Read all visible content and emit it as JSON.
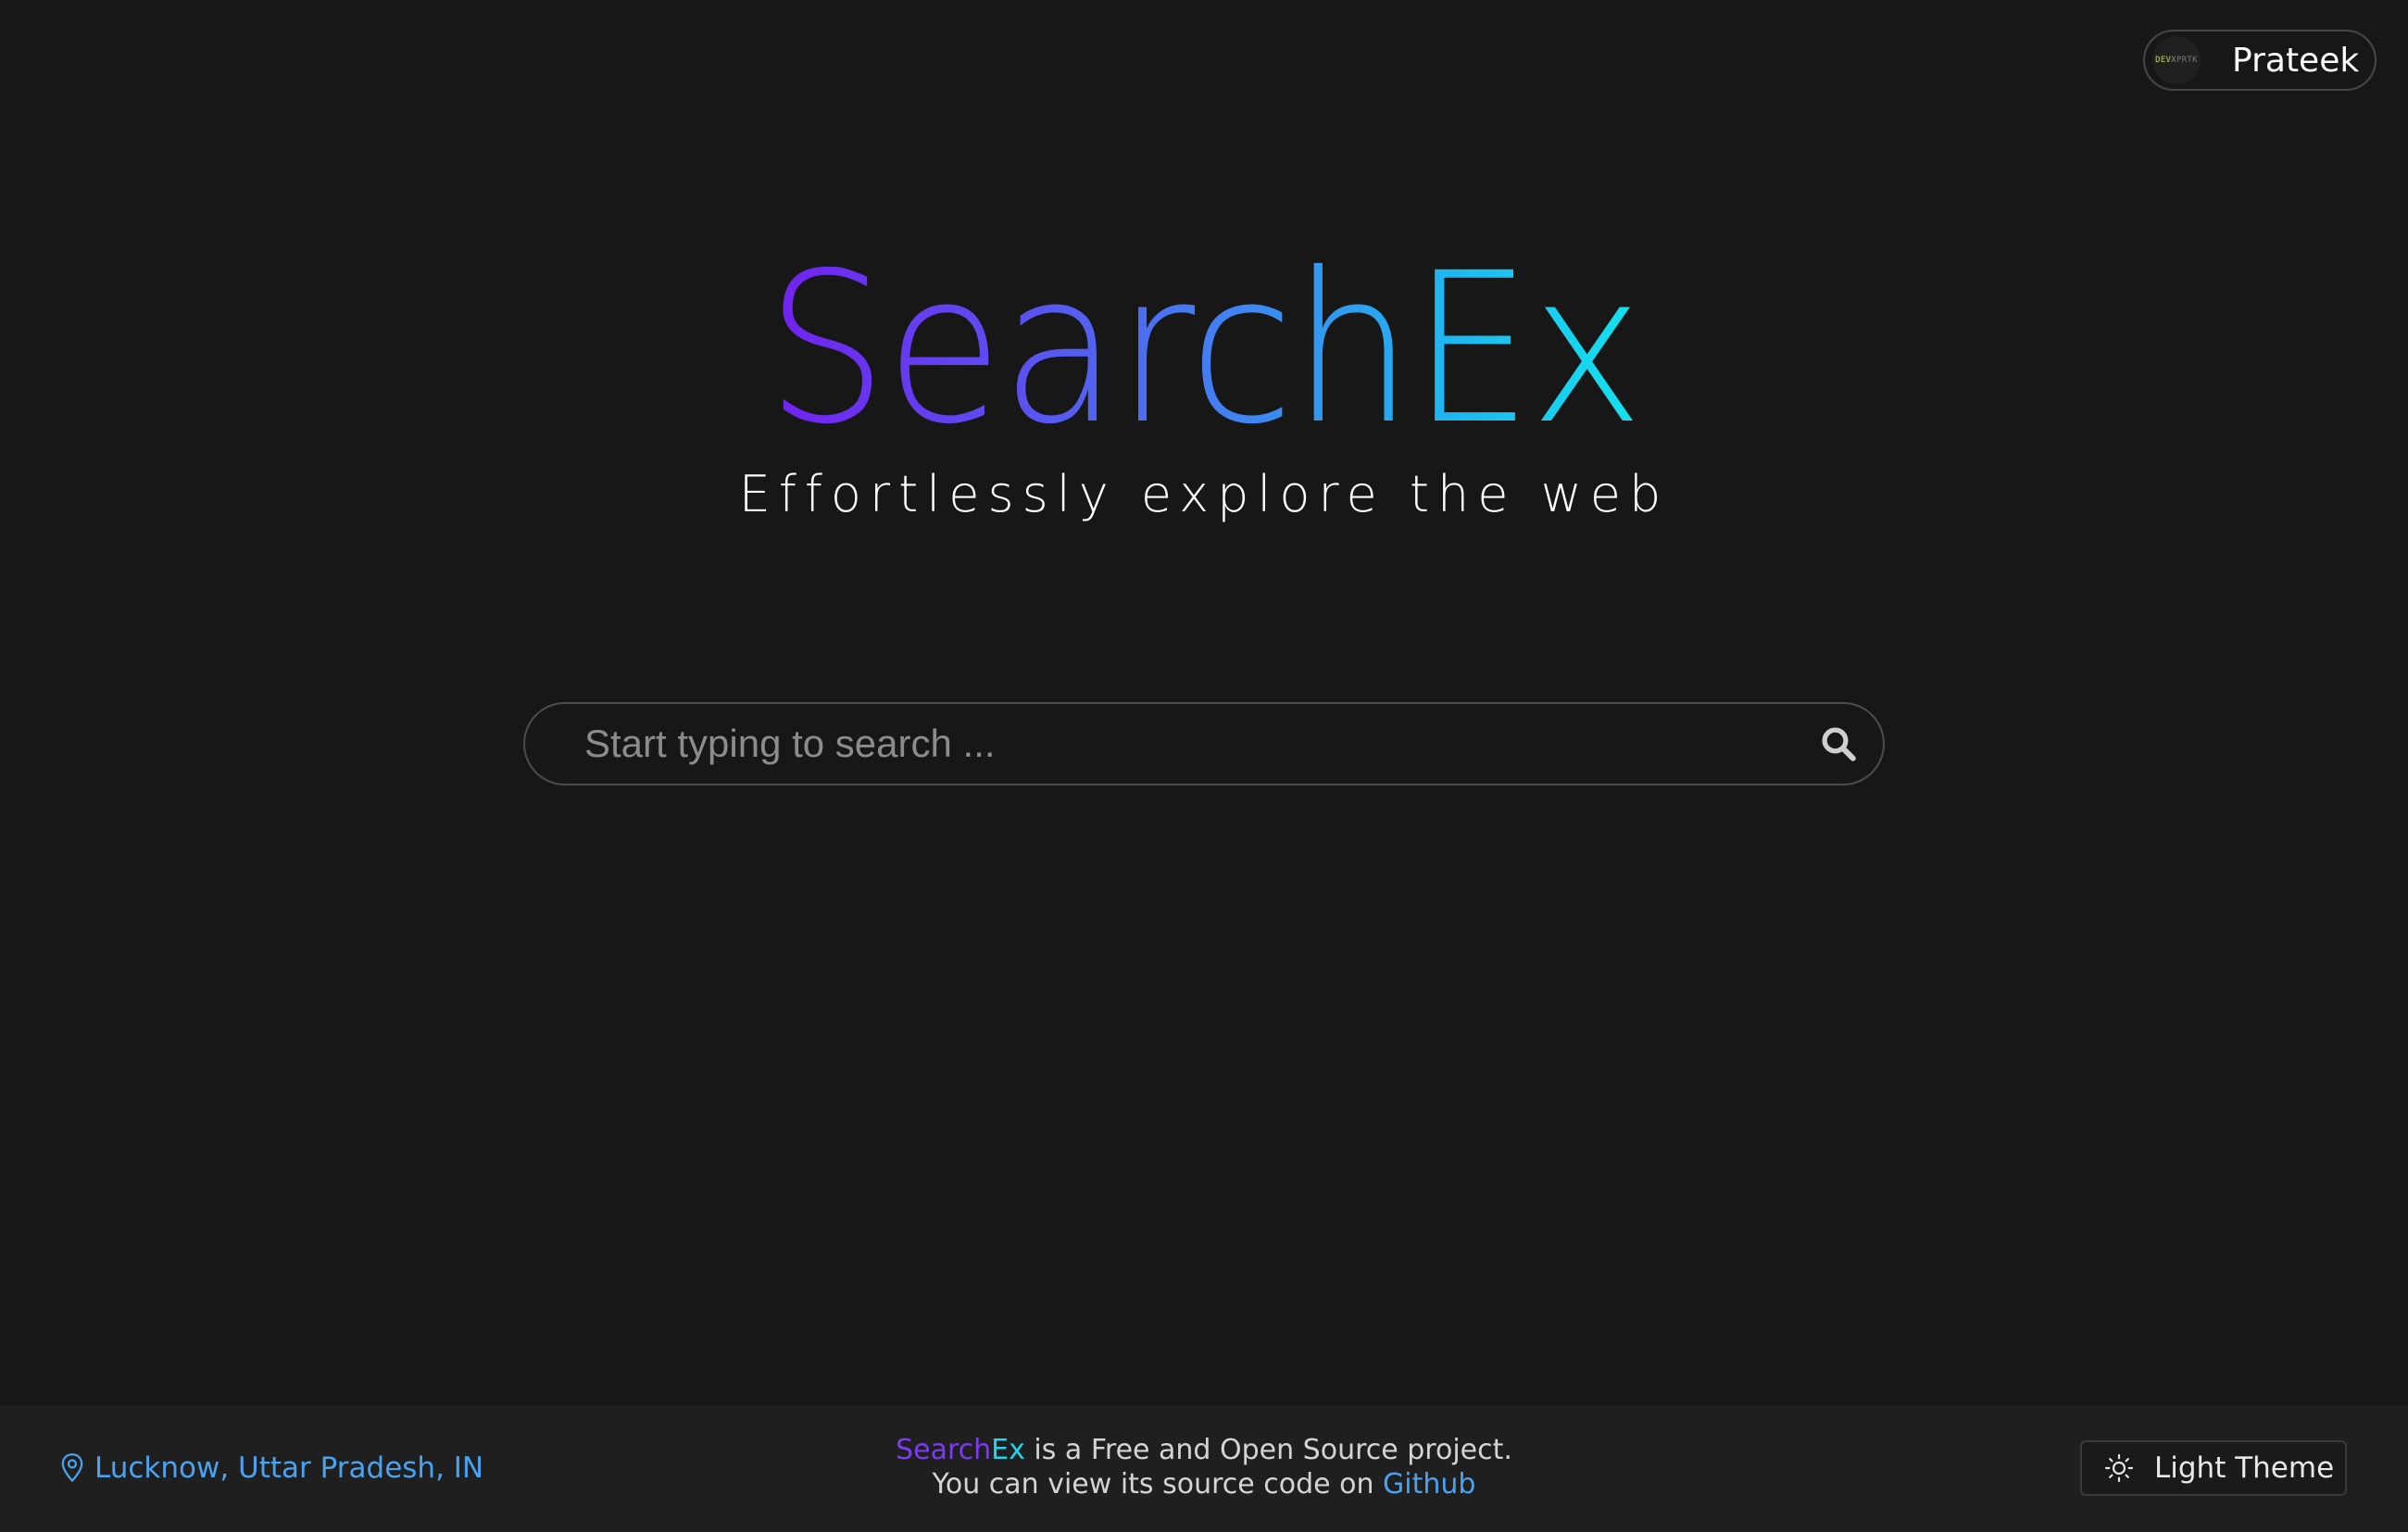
{
  "header": {
    "user_name": "Prateek",
    "avatar": {
      "icon": "avatar-logo",
      "text_part1": "DEV",
      "text_part2": "X",
      "text_part3": "PRTK"
    }
  },
  "hero": {
    "logo_text": "SearchEx",
    "tagline": "Effortlessly explore the web"
  },
  "search": {
    "placeholder": "Start typing to search ...",
    "value": "",
    "icon": "search-icon"
  },
  "footer": {
    "location": "Lucknow, Uttar Pradesh, IN",
    "location_icon": "map-pin-icon",
    "brand_search": "Search",
    "brand_ex": "Ex",
    "line1_rest": " is a Free and Open Source project.",
    "line2_prefix": "You can view its source code on ",
    "github_link": "Github",
    "theme_button_label": "Light Theme",
    "theme_icon": "sun-icon"
  },
  "colors": {
    "background": "#171717",
    "footer_background": "#1f1f1f",
    "gradient_start": "#7221ef",
    "gradient_end": "#14e3ee",
    "link": "#4aa3f0"
  }
}
